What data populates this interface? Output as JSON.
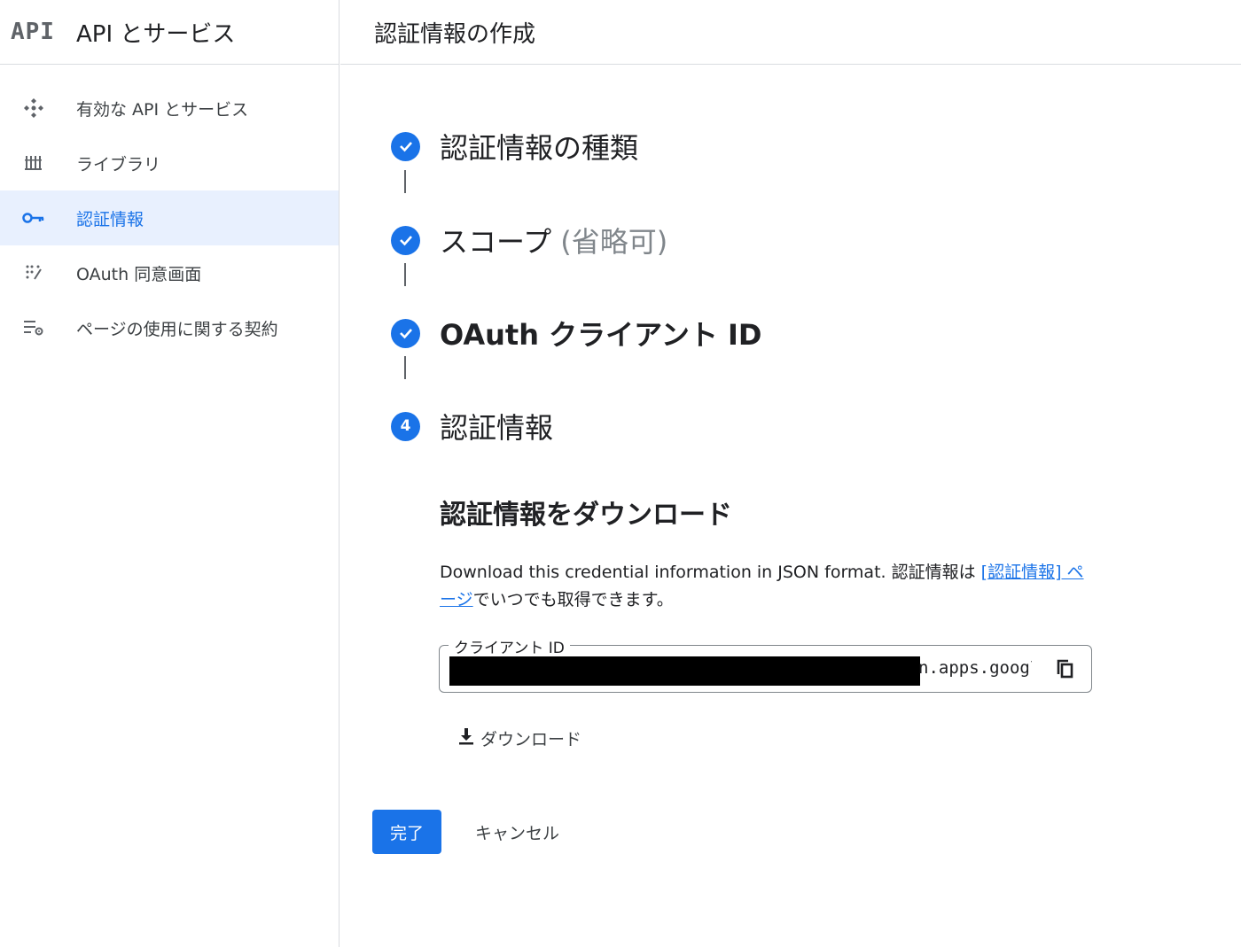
{
  "sidebar": {
    "logo_text": "API",
    "title": "API とサービス",
    "items": [
      {
        "label": "有効な API とサービス",
        "icon": "api-diamond-icon"
      },
      {
        "label": "ライブラリ",
        "icon": "library-icon"
      },
      {
        "label": "認証情報",
        "icon": "key-icon",
        "active": true
      },
      {
        "label": "OAuth 同意画面",
        "icon": "consent-screen-icon"
      },
      {
        "label": "ページの使用に関する契約",
        "icon": "settings-list-icon"
      }
    ]
  },
  "header": {
    "title": "認証情報の作成"
  },
  "steps": [
    {
      "label": "認証情報の種類",
      "status": "done"
    },
    {
      "label": "スコープ",
      "optional": "(省略可)",
      "status": "done"
    },
    {
      "label": "OAuth クライアント ID",
      "status": "done"
    },
    {
      "label": "認証情報",
      "number": "4",
      "status": "current"
    }
  ],
  "download_section": {
    "title": "認証情報をダウンロード",
    "desc_prefix": "Download this credential information in JSON format. 認証情報は ",
    "desc_link": "[認証情報] ページ",
    "desc_suffix": "でいつでも取得できます。",
    "client_id_label": "クライアント ID",
    "client_id_value": "n.apps.googleusercontent.com",
    "download_label": "ダウンロード"
  },
  "actions": {
    "done_label": "完了",
    "cancel_label": "キャンセル"
  },
  "colors": {
    "accent": "#1a73e8",
    "active_bg": "#e8f0fe",
    "border": "#dadce0"
  }
}
